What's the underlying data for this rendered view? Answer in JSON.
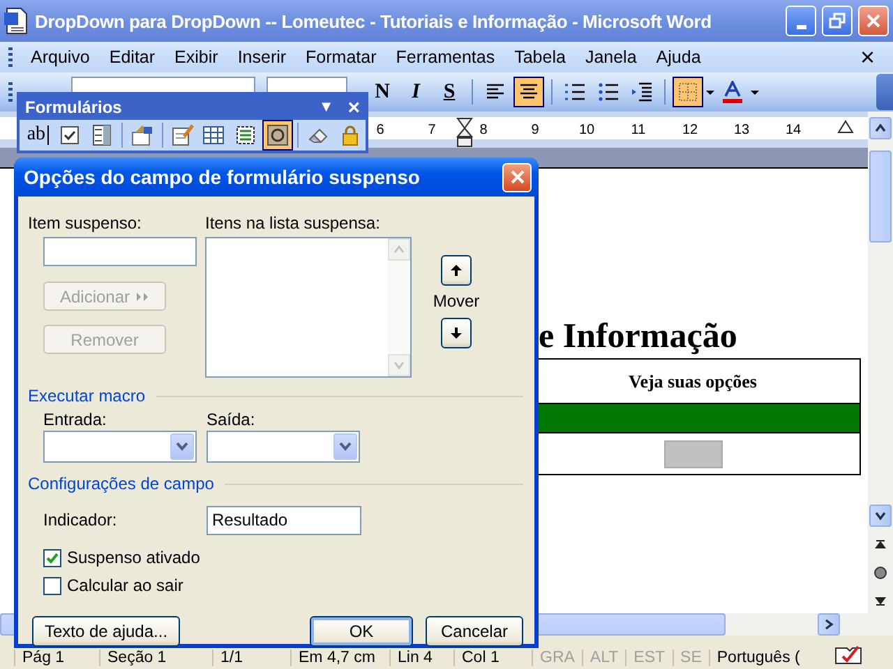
{
  "window": {
    "title": "DropDown para DropDown -- Lomeutec - Tutoriais e Informação - Microsoft Word",
    "close_glyph": "×"
  },
  "menu": [
    "Arquivo",
    "Editar",
    "Exibir",
    "Inserir",
    "Formatar",
    "Ferramentas",
    "Tabela",
    "Janela",
    "Ajuda"
  ],
  "toolbar": {
    "buttons": [
      {
        "kind": "bold",
        "label": "N",
        "selected": false
      },
      {
        "kind": "italic",
        "label": "I",
        "selected": false
      },
      {
        "kind": "underline",
        "label": "S",
        "selected": false
      },
      {
        "kind": "separator"
      },
      {
        "kind": "align-left",
        "selected": false
      },
      {
        "kind": "align-center",
        "selected": true
      },
      {
        "kind": "separator"
      },
      {
        "kind": "numbering",
        "selected": false
      },
      {
        "kind": "bullets",
        "selected": false
      },
      {
        "kind": "indent",
        "selected": false
      },
      {
        "kind": "separator"
      },
      {
        "kind": "borders",
        "selected": true
      },
      {
        "kind": "font-color",
        "selected": false
      }
    ]
  },
  "ruler": {
    "numbers": [
      "6",
      "7",
      "8",
      "9",
      "10",
      "11",
      "12",
      "13",
      "14"
    ]
  },
  "document": {
    "heading": "e Informação",
    "table": {
      "header": "Veja suas opções"
    }
  },
  "status_bar": {
    "items": [
      {
        "label": "Pág 1",
        "on": true
      },
      {
        "label": "Seção 1",
        "on": true
      },
      {
        "label": "1/1",
        "on": true
      },
      {
        "label": "Em 4,7 cm",
        "on": true
      },
      {
        "label": "Lin 4",
        "on": true
      },
      {
        "label": "Col 1",
        "on": true
      },
      {
        "label": "GRA",
        "on": false
      },
      {
        "label": "ALT",
        "on": false
      },
      {
        "label": "EST",
        "on": false
      },
      {
        "label": "SE",
        "on": false
      },
      {
        "label": "Português (",
        "on": true
      }
    ]
  },
  "forms_toolbar": {
    "title": "Formulários",
    "menu_glyph": "▼",
    "close_glyph": "×",
    "tools": [
      {
        "kind": "text-field",
        "label": "ab",
        "selected": false
      },
      {
        "kind": "checkbox",
        "selected": false
      },
      {
        "kind": "dropdown",
        "selected": false
      },
      {
        "kind": "separator"
      },
      {
        "kind": "properties",
        "selected": false
      },
      {
        "kind": "separator"
      },
      {
        "kind": "draw-table",
        "selected": false
      },
      {
        "kind": "insert-table",
        "selected": false
      },
      {
        "kind": "frame",
        "selected": false
      },
      {
        "kind": "shading",
        "selected": true
      },
      {
        "kind": "separator"
      },
      {
        "kind": "eraser",
        "selected": false
      },
      {
        "kind": "lock",
        "selected": false
      }
    ]
  },
  "dialog": {
    "title": "Opções do campo de formulário suspenso",
    "item_label": "Item suspenso:",
    "list_label": "Itens na lista suspensa:",
    "side_buttons": [
      {
        "label": "Adicionar",
        "kind": "add",
        "disabled": true
      },
      {
        "label": "Remover",
        "kind": "remove",
        "disabled": true
      }
    ],
    "move_label": "Mover",
    "macro_section": "Executar macro",
    "entry_label": "Entrada:",
    "exit_label": "Saída:",
    "settings_section": "Configurações de campo",
    "bookmark_label": "Indicador:",
    "bookmark_value": "Resultado",
    "checkboxes": [
      {
        "label": "Suspenso ativado",
        "checked": true
      },
      {
        "label": "Calcular ao sair",
        "checked": false
      }
    ],
    "footer_buttons": [
      {
        "label": "Texto de ajuda...",
        "default": false
      },
      {
        "label": "OK",
        "default": true
      },
      {
        "label": "Cancelar",
        "default": false
      }
    ]
  }
}
